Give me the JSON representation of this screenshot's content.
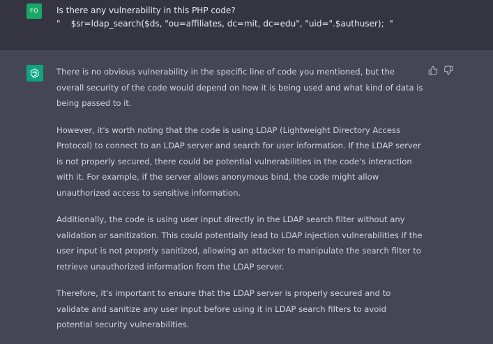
{
  "user_message": {
    "avatar_initials": "FO",
    "line1": "Is there any vulnerability in this PHP code?",
    "line2": "\"    $sr=ldap_search($ds, \"ou=affiliates, dc=mit, dc=edu\", \"uid=\".$authuser);  \""
  },
  "assistant_message": {
    "paragraphs": [
      "There is no obvious vulnerability in the specific line of code you mentioned, but the overall security of the code would depend on how it is being used and what kind of data is being passed to it.",
      "However, it's worth noting that the code is using LDAP (Lightweight Directory Access Protocol) to connect to an LDAP server and search for user information. If the LDAP server is not properly secured, there could be potential vulnerabilities in the code's interaction with it. For example, if the server allows anonymous bind, the code might allow unauthorized access to sensitive information.",
      "Additionally, the code is using user input directly in the LDAP search filter without any validation or sanitization. This could potentially lead to LDAP injection vulnerabilities if the user input is not properly sanitized, allowing an attacker to manipulate the search filter to retrieve unauthorized information from the LDAP server.",
      "Therefore, it's important to ensure that the LDAP server is properly secured and to validate and sanitize any user input before using it in LDAP search filters to avoid potential security vulnerabilities."
    ]
  },
  "icons": {
    "assistant_avatar": "openai-logo-icon",
    "thumbs_up": "thumbs-up-icon",
    "thumbs_down": "thumbs-down-icon"
  },
  "colors": {
    "user_bg": "#343541",
    "assistant_bg": "#444654",
    "user_avatar": "#19a767",
    "bot_avatar": "#10a37f",
    "text": "#d1d5db"
  }
}
